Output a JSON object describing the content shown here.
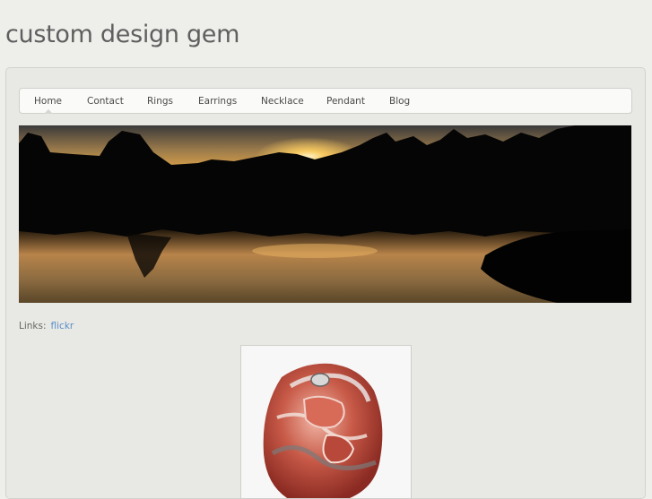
{
  "site": {
    "title": "custom design gem"
  },
  "nav": {
    "items": [
      {
        "label": "Home",
        "active": true
      },
      {
        "label": "Contact",
        "active": false
      },
      {
        "label": "Rings",
        "active": false
      },
      {
        "label": "Earrings",
        "active": false
      },
      {
        "label": "Necklace",
        "active": false
      },
      {
        "label": "Pendant",
        "active": false
      },
      {
        "label": "Blog",
        "active": false
      }
    ]
  },
  "banner": {
    "description_icon": "sunset-lake-photo"
  },
  "links": {
    "label": "Links:",
    "items": [
      {
        "label": "flickr"
      }
    ]
  },
  "product": {
    "icon": "gemstone-pendant-photo"
  },
  "colors": {
    "link": "#5b8fc7",
    "title": "#5f5f5f",
    "background": "#eeeeea"
  }
}
